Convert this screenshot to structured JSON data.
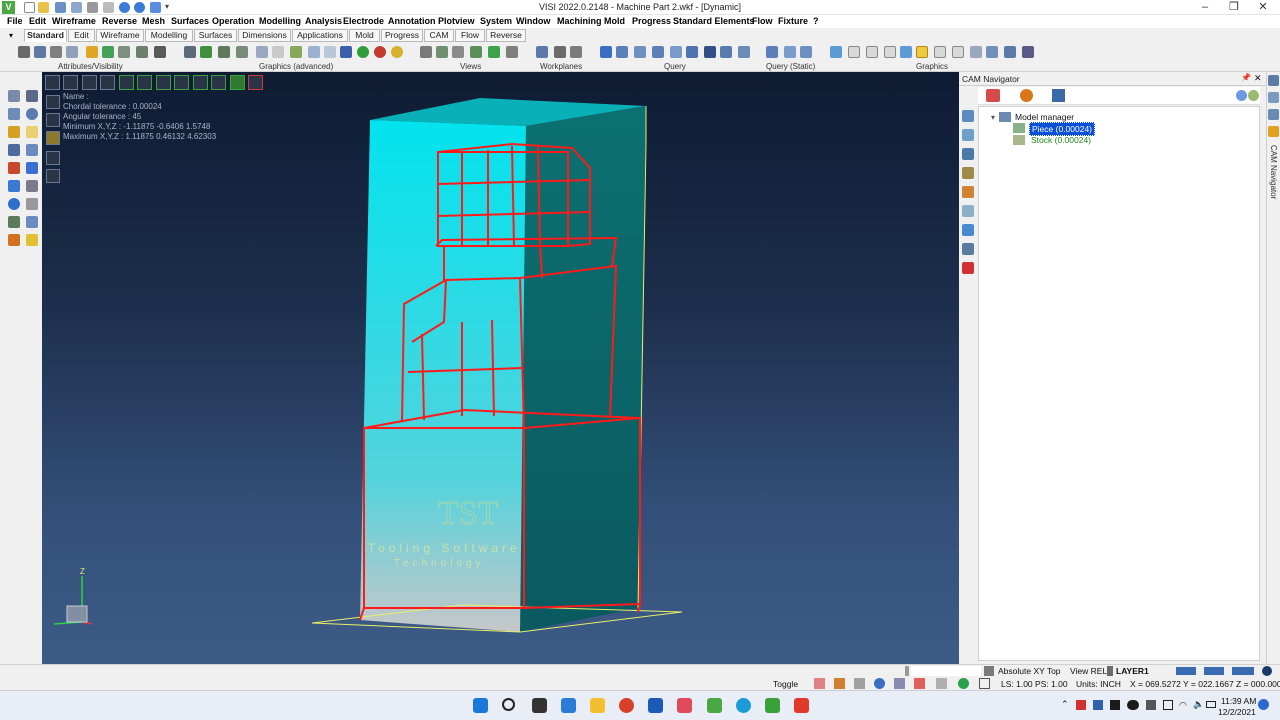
{
  "window": {
    "title": "VISI 2022.0.2148 - Machine Part 2.wkf - [Dynamic]",
    "app_icon": "visi-logo-icon",
    "controls": [
      "minimize-icon",
      "restore-icon",
      "close-icon"
    ]
  },
  "menu": [
    "File",
    "Edit",
    "Wireframe",
    "Reverse",
    "Mesh",
    "Surfaces",
    "Operation",
    "Modelling",
    "Analysis",
    "Electrode",
    "Annotation",
    "Plotview",
    "System",
    "Window",
    "Machining",
    "Mold",
    "Progress",
    "Standard Elements",
    "Flow",
    "Fixture",
    "?"
  ],
  "tabs": [
    {
      "label": "Standard",
      "active": true
    },
    {
      "label": "Edit"
    },
    {
      "label": "Wireframe"
    },
    {
      "label": "Modelling"
    },
    {
      "label": "Surfaces"
    },
    {
      "label": "Dimensions"
    },
    {
      "label": "Applications"
    },
    {
      "label": "Mold"
    },
    {
      "label": "Progress"
    },
    {
      "label": "CAM"
    },
    {
      "label": "Flow"
    },
    {
      "label": "Reverse"
    }
  ],
  "toolbar_groups": [
    "Attributes/Visibility",
    "Graphics (advanced)",
    "Views",
    "Workplanes",
    "Query",
    "Query (Static)",
    "Graphics"
  ],
  "viewport": {
    "info": [
      "Name :",
      "Chordal tolerance : 0.00024",
      "Angular tolerance : 45",
      "Minimum  X,Y,Z : -1.11875 -0.6406 1.5748",
      "Maximum X,Y,Z : 1.11875 0.46132 4.62303"
    ],
    "watermark_logo": "TST",
    "watermark_line1": "Tooling Software",
    "watermark_line2": "Technology",
    "axis_label": "Z",
    "colors": {
      "solid_face": "#00e5ee",
      "dark_face": "#0b6b6b",
      "wire": "#ff1a1a",
      "outline": "#e8ef6a"
    }
  },
  "cam_navigator": {
    "title": "CAM Navigator",
    "tree": {
      "root": "Model manager",
      "children": [
        {
          "label": "Piece (0.00024)",
          "selected": true
        },
        {
          "label": "Stock (0.00024)",
          "selected": false
        }
      ]
    },
    "side_label": "CAM Navigator"
  },
  "status": {
    "toggle": "Toggle",
    "view_plane": "Absolute XY Top",
    "view_rel": "View REL",
    "layer": "LAYER1",
    "ls_ps": "LS: 1.00 PS: 1.00",
    "units": "Units: INCH",
    "coords": "X = 069.5272 Y = 022.1667 Z = 000.0000"
  },
  "clock": {
    "time": "11:39 AM",
    "date": "12/2/2021"
  }
}
